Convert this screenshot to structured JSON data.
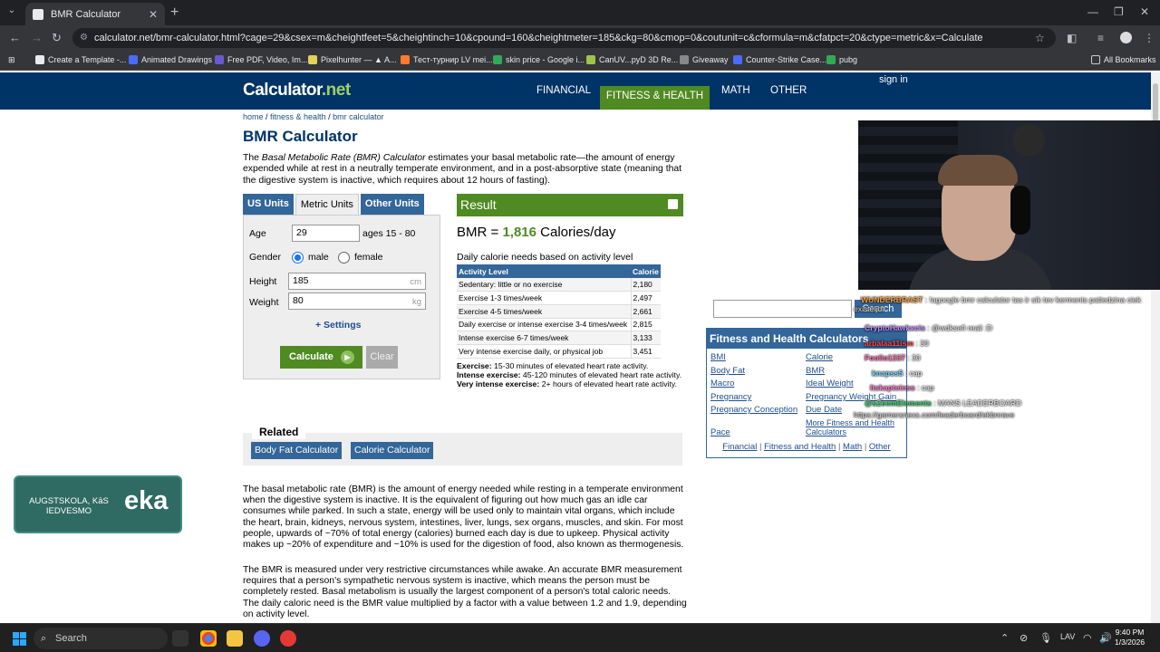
{
  "browser": {
    "tab_title": "BMR Calculator",
    "url": "calculator.net/bmr-calculator.html?cage=29&csex=m&cheightfeet=5&cheightinch=10&cpound=160&cheightmeter=185&ckg=80&cmop=0&coutunit=c&cformula=m&cfatpct=20&ctype=metric&x=Calculate",
    "bookmarks": [
      "Create a Template -...",
      "Animated Drawings",
      "Free PDF, Video, Im...",
      "Pixelhunter — ▲ A...",
      "Тест-турнир LV mei...",
      "skin price - Google i...",
      "CanUV...pyD 3D Re...",
      "Giveaway",
      "Counter-Strike Case...",
      "pubg"
    ],
    "all_bookmarks": "All Bookmarks"
  },
  "site": {
    "logo_main": "Calculator",
    "logo_suffix": ".net",
    "nav": [
      "FINANCIAL",
      "FITNESS & HEALTH",
      "MATH",
      "OTHER"
    ],
    "sign_in": "sign in",
    "breadcrumb": [
      "home",
      "fitness & health",
      "bmr calculator"
    ]
  },
  "page": {
    "title": "BMR Calculator",
    "intro_1": "The ",
    "intro_italic": "Basal Metabolic Rate (BMR) Calculator",
    "intro_2": " estimates your basal metabolic rate—the amount of energy expended while at rest in a neutrally temperate environment, and in a post-absorptive state (meaning that the digestive system is inactive, which requires about 12 hours of fasting).",
    "unit_tabs": [
      "US Units",
      "Metric Units",
      "Other Units"
    ],
    "form": {
      "age_label": "Age",
      "age_value": "29",
      "age_hint": "ages 15 - 80",
      "gender_label": "Gender",
      "male": "male",
      "female": "female",
      "height_label": "Height",
      "height_value": "185",
      "height_unit": "cm",
      "weight_label": "Weight",
      "weight_value": "80",
      "weight_unit": "kg",
      "settings": "+ Settings",
      "calculate": "Calculate",
      "clear": "Clear"
    },
    "result": {
      "header": "Result",
      "bmr_prefix": "BMR = ",
      "bmr_value": "1,816",
      "bmr_suffix": " Calories/day",
      "daily_label": "Daily calorie needs based on activity level",
      "col_activity": "Activity Level",
      "col_calorie": "Calorie",
      "rows": [
        {
          "level": "Sedentary: little or no exercise",
          "cal": "2,180"
        },
        {
          "level": "Exercise 1-3 times/week",
          "cal": "2,497"
        },
        {
          "level": "Exercise 4-5 times/week",
          "cal": "2,661"
        },
        {
          "level": "Daily exercise or intense exercise 3-4 times/week",
          "cal": "2,815"
        },
        {
          "level": "Intense exercise 6-7 times/week",
          "cal": "3,133"
        },
        {
          "level": "Very intense exercise daily, or physical job",
          "cal": "3,451"
        }
      ],
      "notes": [
        {
          "k": "Exercise:",
          "v": " 15-30 minutes of elevated heart rate activity."
        },
        {
          "k": "Intense exercise:",
          "v": " 45-120 minutes of elevated heart rate activity."
        },
        {
          "k": "Very intense exercise:",
          "v": " 2+ hours of elevated heart rate activity."
        }
      ]
    },
    "related": {
      "title": "Related",
      "links": [
        "Body Fat Calculator",
        "Calorie Calculator"
      ]
    },
    "para1": "The basal metabolic rate (BMR) is the amount of energy needed while resting in a temperate environment when the digestive system is inactive. It is the equivalent of figuring out how much gas an idle car consumes while parked. In such a state, energy will be used only to maintain vital organs, which include the heart, brain, kidneys, nervous system, intestines, liver, lungs, sex organs, muscles, and skin. For most people, upwards of ~70% of total energy (calories) burned each day is due to upkeep. Physical activity makes up ~20% of expenditure and ~10% is used for the digestion of food, also known as thermogenesis.",
    "para2": "The BMR is measured under very restrictive circumstances while awake. An accurate BMR measurement requires that a person's sympathetic nervous system is inactive, which means the person must be completely rested. Basal metabolism is usually the largest component of a person's total caloric needs. The daily caloric need is the BMR value multiplied by a factor with a value between 1.2 and 1.9, depending on activity level."
  },
  "sidebar": {
    "search_button": "Search",
    "box_title": "Fitness and Health Calculators",
    "links_left": [
      "BMI",
      "Body Fat",
      "Macro",
      "Pregnancy",
      "Pregnancy Conception",
      "Pace"
    ],
    "links_right": [
      "Calorie",
      "BMR",
      "Ideal Weight",
      "Pregnancy Weight Gain",
      "Due Date",
      "More Fitness and Health Calculators"
    ],
    "footer": [
      "Financial",
      "Fitness and Health",
      "Math",
      "Other"
    ]
  },
  "overlay": {
    "chat": [
      {
        "user": "WUNDERBRAST",
        "msg": " : !agoogle bmr calculator tas ir sik tev kermenis patiedzina ciek"
      },
      {
        "user": "CryptoHawkxcis",
        "msg": " : @wdksefi reali :D"
      },
      {
        "user": "arbalaa11ism",
        "msg": " : 30"
      },
      {
        "user": "Foolio1337",
        "msg": " : 30"
      },
      {
        "user": "knapss5",
        "msg": " : cap"
      },
      {
        "user": "Itskapteinss",
        "msg": " : cap"
      },
      {
        "user": "@sZeemElements",
        "msg": " : MANS LEADERBOARD"
      },
      {
        "user": "",
        "msg": "https://gamersnexs.com/leaderboard/ekbnrave"
      }
    ],
    "chat_extra": "existeljot",
    "banner_line1": "AUGSTSKOLA, KāS IEDVESMO",
    "banner_line2": "eka"
  },
  "taskbar": {
    "search": "Search",
    "lang": "LAV",
    "time": "9:40 PM",
    "date": "1/3/2026"
  }
}
